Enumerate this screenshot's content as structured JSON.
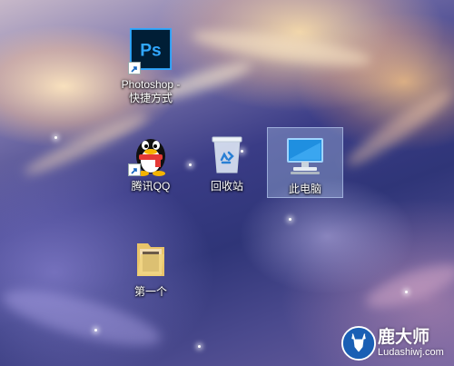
{
  "desktop": {
    "icons": [
      {
        "label_line1": "Photoshop -",
        "label_line2": "快捷方式"
      },
      {
        "label": "腾讯QQ"
      },
      {
        "label": "回收站"
      },
      {
        "label": "此电脑"
      },
      {
        "label": "第一个"
      }
    ]
  },
  "watermark": {
    "title": "鹿大师",
    "subtitle": "Ludashiwj.com"
  },
  "icons": {
    "photoshop": "photoshop-icon",
    "qq": "qq-penguin-icon",
    "recycle": "recycle-bin-icon",
    "computer": "monitor-icon",
    "folder": "folder-icon"
  },
  "colors": {
    "photoshop_bg": "#001e36",
    "photoshop_text": "#31a8ff",
    "selection": "#b4cdf0"
  }
}
